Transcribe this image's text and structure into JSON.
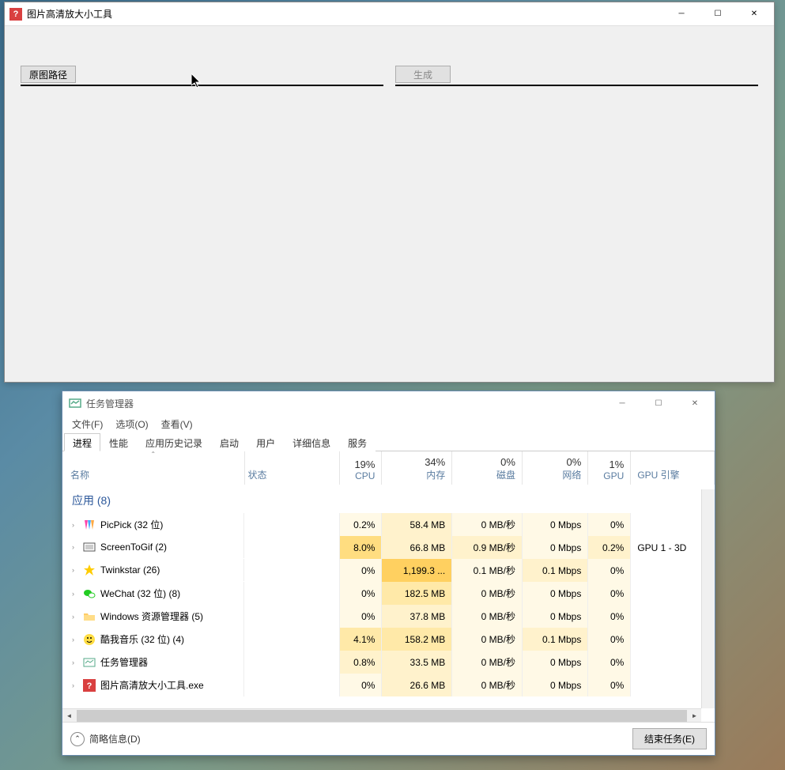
{
  "win1": {
    "title": "图片高清放大小工具",
    "btn_source": "原图路径",
    "btn_generate": "生成"
  },
  "win2": {
    "title": "任务管理器",
    "menu": {
      "file": "文件(F)",
      "options": "选项(O)",
      "view": "查看(V)"
    },
    "tabs": [
      "进程",
      "性能",
      "应用历史记录",
      "启动",
      "用户",
      "详细信息",
      "服务"
    ],
    "columns": {
      "name": "名称",
      "status": "状态",
      "cpu": {
        "pct": "19%",
        "label": "CPU"
      },
      "mem": {
        "pct": "34%",
        "label": "内存"
      },
      "disk": {
        "pct": "0%",
        "label": "磁盘"
      },
      "net": {
        "pct": "0%",
        "label": "网络"
      },
      "gpu": {
        "pct": "1%",
        "label": "GPU"
      },
      "gpu_engine": "GPU 引擎"
    },
    "group": "应用 (8)",
    "rows": [
      {
        "name": "PicPick (32 位)",
        "cpu": "0.2%",
        "mem": "58.4 MB",
        "disk": "0 MB/秒",
        "net": "0 Mbps",
        "gpu": "0%",
        "engine": "",
        "heat": {
          "cpu": 0,
          "mem": 1,
          "disk": 0,
          "net": 0,
          "gpu": 0
        },
        "icon": "picpick"
      },
      {
        "name": "ScreenToGif (2)",
        "cpu": "8.0%",
        "mem": "66.8 MB",
        "disk": "0.9 MB/秒",
        "net": "0 Mbps",
        "gpu": "0.2%",
        "engine": "GPU 1 - 3D",
        "heat": {
          "cpu": 3,
          "mem": 1,
          "disk": 1,
          "net": 0,
          "gpu": 1
        },
        "icon": "gif"
      },
      {
        "name": "Twinkstar (26)",
        "cpu": "0%",
        "mem": "1,199.3 ...",
        "disk": "0.1 MB/秒",
        "net": "0.1 Mbps",
        "gpu": "0%",
        "engine": "",
        "heat": {
          "cpu": 0,
          "mem": 4,
          "disk": 0,
          "net": 1,
          "gpu": 0
        },
        "icon": "star"
      },
      {
        "name": "WeChat (32 位) (8)",
        "cpu": "0%",
        "mem": "182.5 MB",
        "disk": "0 MB/秒",
        "net": "0 Mbps",
        "gpu": "0%",
        "engine": "",
        "heat": {
          "cpu": 0,
          "mem": 2,
          "disk": 0,
          "net": 0,
          "gpu": 0
        },
        "icon": "wechat"
      },
      {
        "name": "Windows 资源管理器 (5)",
        "cpu": "0%",
        "mem": "37.8 MB",
        "disk": "0 MB/秒",
        "net": "0 Mbps",
        "gpu": "0%",
        "engine": "",
        "heat": {
          "cpu": 0,
          "mem": 1,
          "disk": 0,
          "net": 0,
          "gpu": 0
        },
        "icon": "explorer"
      },
      {
        "name": "酷我音乐 (32 位) (4)",
        "cpu": "4.1%",
        "mem": "158.2 MB",
        "disk": "0 MB/秒",
        "net": "0.1 Mbps",
        "gpu": "0%",
        "engine": "",
        "heat": {
          "cpu": 2,
          "mem": 2,
          "disk": 0,
          "net": 1,
          "gpu": 0
        },
        "icon": "kuwo"
      },
      {
        "name": "任务管理器",
        "cpu": "0.8%",
        "mem": "33.5 MB",
        "disk": "0 MB/秒",
        "net": "0 Mbps",
        "gpu": "0%",
        "engine": "",
        "heat": {
          "cpu": 1,
          "mem": 1,
          "disk": 0,
          "net": 0,
          "gpu": 0
        },
        "icon": "taskmgr"
      },
      {
        "name": "图片高清放大小工具.exe",
        "cpu": "0%",
        "mem": "26.6 MB",
        "disk": "0 MB/秒",
        "net": "0 Mbps",
        "gpu": "0%",
        "engine": "",
        "heat": {
          "cpu": 0,
          "mem": 1,
          "disk": 0,
          "net": 0,
          "gpu": 0
        },
        "icon": "redq"
      }
    ],
    "footer": {
      "fewer": "简略信息(D)",
      "end_task": "结束任务(E)"
    }
  }
}
